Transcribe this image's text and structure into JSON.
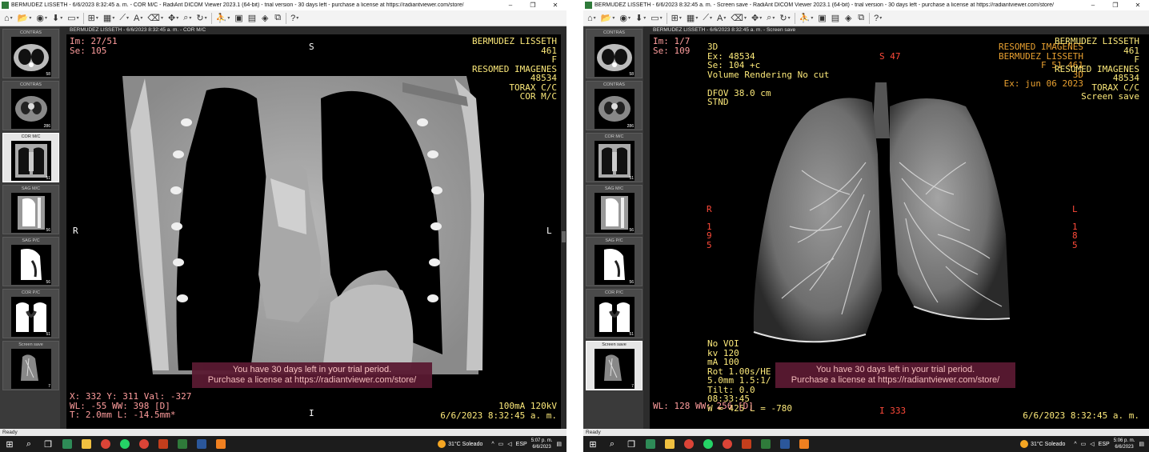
{
  "left": {
    "window_title": "BERMUDEZ LISSETH - 6/6/2023 8:32:45 a. m. - COR M/C - RadiAnt DICOM Viewer 2023.1 (64-bit) - trial version - 30 days left - purchase a license at https://radiantviewer.com/store/",
    "viewer_title": "BERMUDEZ LISSETH - 6/6/2023 8:32:45 a. m. - COR M/C",
    "tl": [
      "Im: 27/51",
      "Se: 105"
    ],
    "tr": [
      "BERMUDEZ LISSETH",
      "461",
      "F",
      "RESOMED IMAGENES",
      "48534",
      "TORAX C/C",
      "COR M/C"
    ],
    "bl": [
      "X: 332 Y: 311 Val: -327",
      "WL: -55 WW: 398 [D]",
      "T: 2.0mm L: -14.5mm*"
    ],
    "br": [
      "100mA 120kV",
      "6/6/2023 8:32:45 a. m."
    ],
    "orient": {
      "top": "S",
      "bottom": "I",
      "left": "R",
      "right": "L"
    },
    "status": "Ready",
    "weather": "31°C Soleado",
    "time": "5:07 p. m.",
    "date": "6/6/2023"
  },
  "right": {
    "window_title": "BERMUDEZ LISSETH - 6/6/2023 8:32:45 a. m. - Screen save - RadiAnt DICOM Viewer 2023.1 (64-bit) - trial version - 30 days left - purchase a license at https://radiantviewer.com/store/",
    "viewer_title": "BERMUDEZ LISSETH - 6/6/2023 8:32:45 a. m. - Screen save",
    "tl": [
      "Im: 1/7",
      "Se: 109"
    ],
    "tr": [
      "BERMUDEZ LISSETH",
      "461",
      "F",
      "RESOMED IMAGENES",
      "48534",
      "TORAX C/C",
      "Screen save"
    ],
    "bl": [
      "WL: 128 WW: 256 [D]"
    ],
    "br": [
      "6/6/2023 8:32:45 a. m."
    ],
    "burned_tl": [
      "3D",
      "Ex: 48534",
      "Se: 104 +c",
      "Volume Rendering  No cut",
      "",
      "DFOV 38.0 cm",
      "STND"
    ],
    "burned_tr": [
      "RESOMED IMAGENES",
      "BERMUDEZ LISSETH",
      "F 51  461",
      "3D",
      "Ex: jun 06 2023"
    ],
    "burned_bl": [
      "No VOI",
      "kv 120",
      "mA 100",
      "Rot 1.00s/HE",
      "5.0mm 1.5:1/",
      "Tilt: 0.0",
      "08:33:45",
      "W = 425 L = -780"
    ],
    "red_top": "S 47",
    "red_bottom": "I 333",
    "red_left": [
      "R",
      "1",
      "9",
      "5"
    ],
    "red_right": [
      "L",
      "1",
      "8",
      "5"
    ],
    "status": "Ready",
    "weather": "31°C Soleado",
    "time": "5:06 p. m.",
    "date": "6/6/2023"
  },
  "banner": [
    "You have 30 days left in your trial period.",
    "Purchase a license at https://radiantviewer.com/store/"
  ],
  "window_buttons": [
    "–",
    "❐",
    "✕"
  ],
  "series_left": [
    {
      "label": "CONTRAS",
      "count": "58"
    },
    {
      "label": "CONTRAS",
      "count": "286"
    },
    {
      "label": "COR M/C",
      "count": "51"
    },
    {
      "label": "SAG M/C",
      "count": "56"
    },
    {
      "label": "SAG P/C",
      "count": "56"
    },
    {
      "label": "COR P/C",
      "count": "51"
    },
    {
      "label": "Screen save",
      "count": "7"
    }
  ],
  "series_right": [
    {
      "label": "CONTRAS",
      "count": "58"
    },
    {
      "label": "CONTRAS",
      "count": "286"
    },
    {
      "label": "COR M/C",
      "count": "51"
    },
    {
      "label": "SAG M/C",
      "count": "56"
    },
    {
      "label": "SAG P/C",
      "count": "56"
    },
    {
      "label": "COR P/C",
      "count": "51"
    },
    {
      "label": "Screen save",
      "count": "7"
    }
  ],
  "sys_tray": {
    "lang": "ESP"
  }
}
